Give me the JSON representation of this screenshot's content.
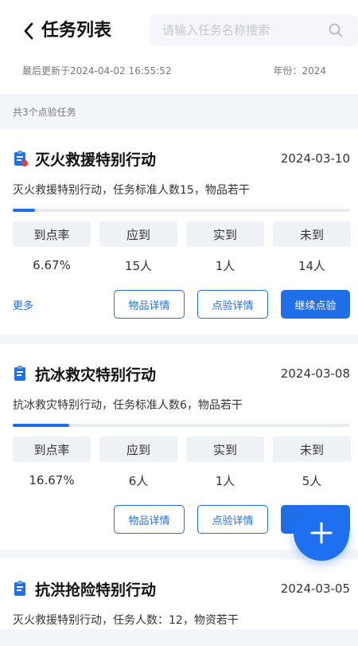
{
  "header": {
    "title": "任务列表",
    "search_placeholder": "请输入任务名称搜索",
    "last_updated": "最后更新于2024-04-02 16:55:52",
    "year": "年份：2024"
  },
  "summary": {
    "count_text": "共3个点验任务"
  },
  "tasks": [
    {
      "title": "灭火救援特别行动",
      "date": "2024-03-10",
      "description": "灭火救援特别行动，任务标准人数15，物品若干",
      "progress": 0.0667,
      "stats": [
        {
          "label": "到点率",
          "value": "6.67%"
        },
        {
          "label": "应到",
          "value": "15人"
        },
        {
          "label": "实到",
          "value": "1人"
        },
        {
          "label": "未到",
          "value": "14人"
        }
      ],
      "more": "更多",
      "btn_items": "物品详情",
      "btn_check": "点验详情",
      "btn_continue": "继续点验",
      "icon_color": "#1e6fe8",
      "icon_dot": "#e83a3a"
    },
    {
      "title": "抗冰救灾特别行动",
      "date": "2024-03-08",
      "description": "抗冰救灾特别行动，任务标准人数6，物品若干",
      "progress": 0.1667,
      "stats": [
        {
          "label": "到点率",
          "value": "16.67%"
        },
        {
          "label": "应到",
          "value": "6人"
        },
        {
          "label": "实到",
          "value": "1人"
        },
        {
          "label": "未到",
          "value": "5人"
        }
      ],
      "btn_items": "物品详情",
      "btn_check": "点验详情",
      "icon_color": "#1e6fe8"
    },
    {
      "title": "抗洪抢险特别行动",
      "date": "2024-03-05",
      "description": "灭火救援特别行动，任务人数：12，物资若干",
      "icon_color": "#1e6fe8"
    }
  ],
  "fab": {
    "icon": "plus-icon",
    "color": "#1f70f0"
  }
}
